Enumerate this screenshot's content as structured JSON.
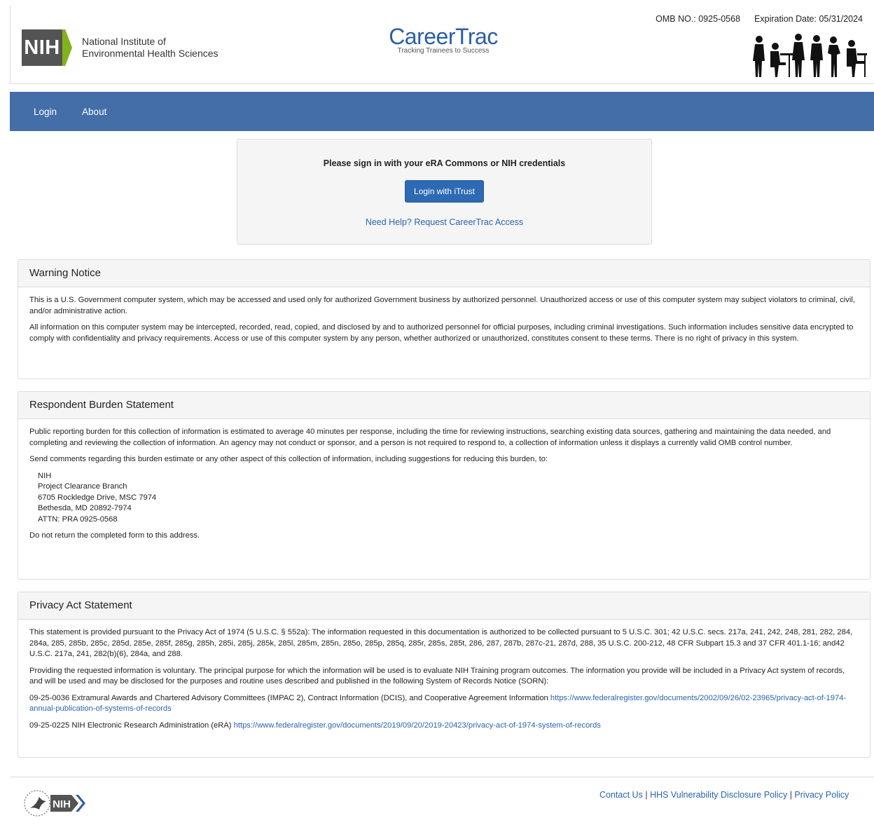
{
  "header": {
    "nih_logo_text": "NIH",
    "nih_org_line1": "National Institute of",
    "nih_org_line2": "Environmental Health Sciences",
    "app_title": "CareerTrac",
    "app_tagline": "Tracking Trainees to Success",
    "omb_number": "OMB NO.: 0925-0568",
    "expiration": "Expiration Date: 05/31/2024"
  },
  "nav": {
    "items": [
      {
        "label": "Login"
      },
      {
        "label": "About"
      }
    ]
  },
  "login": {
    "prompt": "Please sign in with your eRA Commons or NIH credentials",
    "button_label": "Login with iTrust",
    "help_link": "Need Help? Request CareerTrac Access"
  },
  "warning": {
    "title": "Warning Notice",
    "p1": "This is a U.S. Government computer system, which may be accessed and used only for authorized Government business by authorized personnel. Unauthorized access or use of this computer system may subject violators to criminal, civil, and/or administrative action.",
    "p2": "All information on this computer system may be intercepted, recorded, read, copied, and disclosed by and to authorized personnel for official purposes, including criminal investigations. Such information includes sensitive data encrypted to comply with confidentiality and privacy requirements. Access or use of this computer system by any person, whether authorized or unauthorized, constitutes consent to these terms. There is no right of privacy in this system."
  },
  "burden": {
    "title": "Respondent Burden Statement",
    "p1": "Public reporting burden for this collection of information is estimated to average 40 minutes per response, including the time for reviewing instructions, searching existing data sources, gathering and maintaining the data needed, and completing and reviewing the collection of information. An agency may not conduct or sponsor, and a person is not required to respond to, a collection of information unless it displays a currently valid OMB control number.",
    "p2": "Send comments regarding this burden estimate or any other aspect of this collection of information, including suggestions for reducing this burden, to:",
    "address": [
      "NIH",
      "Project Clearance Branch",
      "6705 Rockledge Drive, MSC 7974",
      "Bethesda, MD 20892-7974",
      "ATTN: PRA 0925-0568"
    ],
    "p3": "Do not return the completed form to this address."
  },
  "privacy": {
    "title": "Privacy Act Statement",
    "p1": "This statement is provided pursuant to the Privacy Act of 1974 (5 U.S.C. § 552a): The information requested in this documentation is authorized to be collected pursuant to 5 U.S.C. 301; 42 U.S.C. secs. 217a, 241, 242, 248, 281, 282, 284, 284a, 285, 285b, 285c, 285d, 285e, 285f, 285g, 285h, 285i, 285j, 285k, 285l, 285m, 285n, 285o, 285p, 285q, 285r, 285s, 285t, 286, 287, 287b, 287c-21, 287d, 288, 35 U.S.C. 200-212, 48 CFR Subpart 15.3 and 37 CFR 401.1-16; and42 U.S.C. 217a, 241, 282(b)(6), 284a, and 288.",
    "p2": "Providing the requested information is voluntary. The principal purpose for which the information will be used is to evaluate NIH Training program outcomes. The information you provide will be included in a Privacy Act system of records, and will be used and may be disclosed for the purposes and routine uses described and published in the following System of Records Notice (SORN):",
    "sorn1_text": "09-25-0036 Extramural Awards and Chartered Advisory Committees (IMPAC 2), Contract Information (DCIS), and Cooperative Agreement Information",
    "sorn1_link": "https://www.federalregister.gov/documents/2002/09/26/02-23965/privacy-act-of-1974-annual-publication-of-systems-of-records",
    "sorn2_text": "09-25-0225 NIH Electronic Research Administration (eRA)",
    "sorn2_link": "https://www.federalregister.gov/documents/2019/09/20/2019-20423/privacy-act-of-1974-system-of-records"
  },
  "footer": {
    "logo_text": "NIH",
    "contact": "Contact Us",
    "sep": "|",
    "vdp": "HHS Vulnerability Disclosure Policy",
    "privacy": "Privacy Policy"
  }
}
